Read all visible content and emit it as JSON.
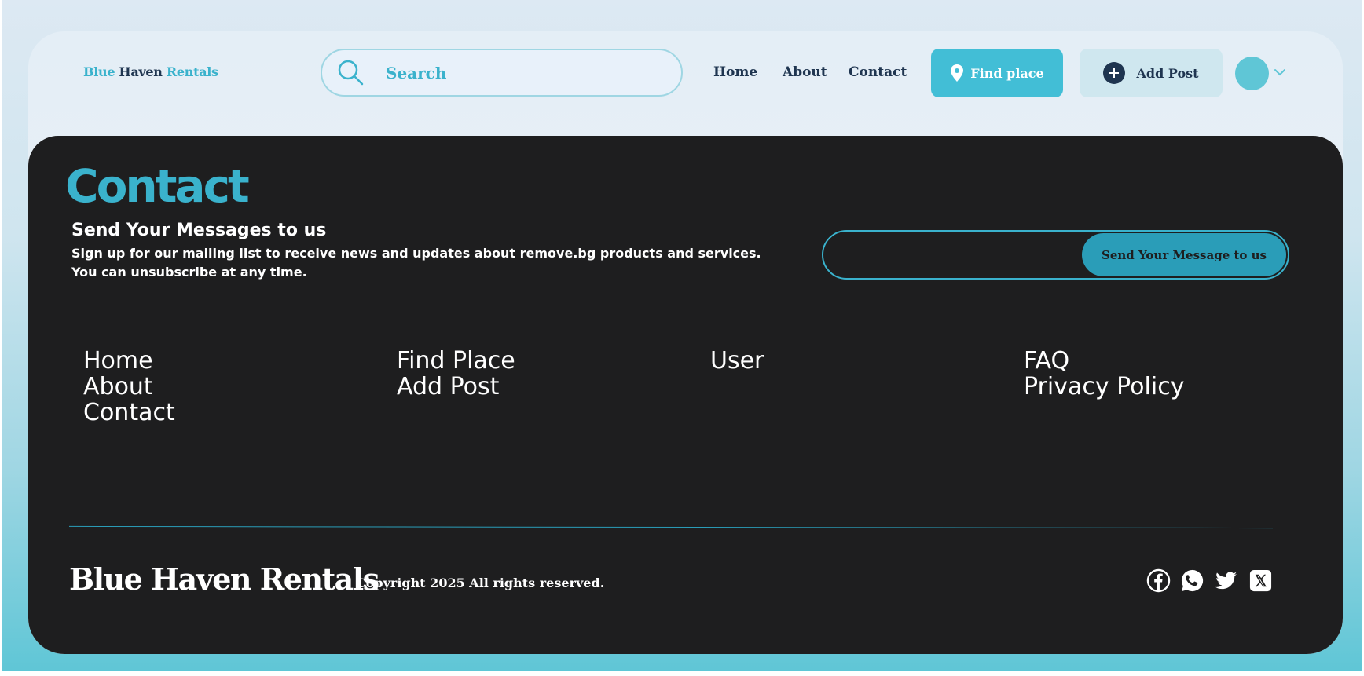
{
  "header": {
    "brand": {
      "part1": "Blue",
      "part2": "Haven",
      "part3": "Rentals"
    },
    "search": {
      "label": "Search"
    },
    "nav": [
      "Home",
      "About",
      "Contact"
    ],
    "find_place_label": "Find place",
    "add_post_label": "Add Post"
  },
  "contact": {
    "title": "Contact",
    "heading": "Send Your Messages to us",
    "subtext": "Sign up for our mailing list to receive news and updates about remove.bg products and services. You can unsubscribe at any time.",
    "email_value": "",
    "send_label": "Send Your Message to us"
  },
  "footer_links": {
    "col1": [
      "Home",
      "About",
      "Contact"
    ],
    "col2": [
      "Find Place",
      "Add Post"
    ],
    "col3": [
      "User"
    ],
    "col4": [
      "FAQ",
      "Privacy Policy"
    ]
  },
  "footer": {
    "brand": "Blue Haven Rentals",
    "copyright": "Copyright 2025 All rights reserved.",
    "social_icons": [
      "facebook-icon",
      "whatsapp-icon",
      "twitter-icon",
      "x-icon"
    ]
  },
  "colors": {
    "accent": "#3ab2cc",
    "accent_button": "#42bed6",
    "navy": "#1f3550",
    "panel": "#1e1e1f"
  }
}
